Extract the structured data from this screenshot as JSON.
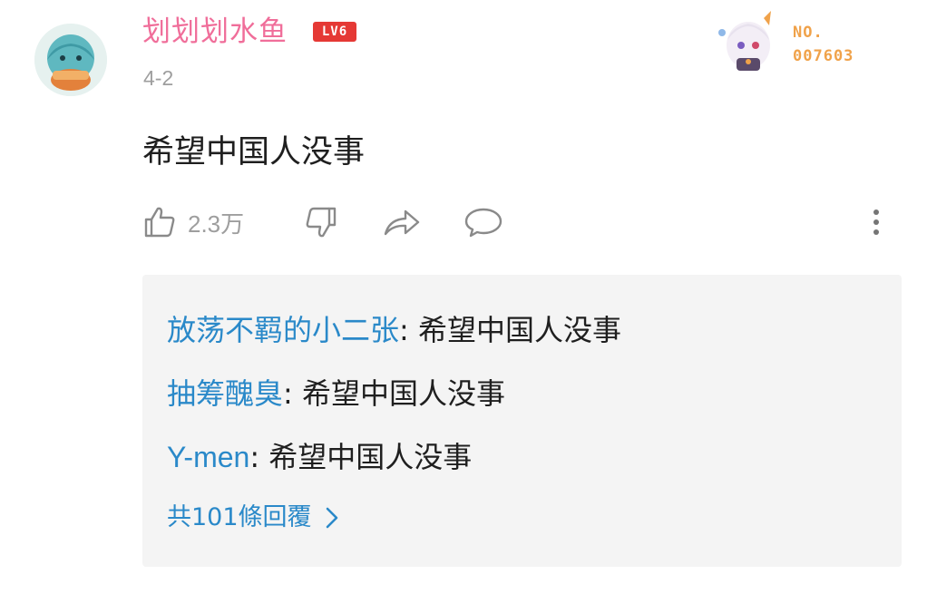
{
  "comment": {
    "username": "划划划水鱼",
    "level": "LV6",
    "date": "4-2",
    "text": "希望中国人没事",
    "fan_badge": {
      "label": "NO.",
      "number": "007603"
    }
  },
  "actions": {
    "like_count": "2.3万",
    "like_icon": "thumbs-up-icon",
    "dislike_icon": "thumbs-down-icon",
    "share_icon": "share-icon",
    "reply_icon": "comment-bubble-icon",
    "more_icon": "more-vertical-icon"
  },
  "replies": {
    "items": [
      {
        "author": "放荡不羁的小二张",
        "separator": ": ",
        "content": "希望中国人没事"
      },
      {
        "author": "抽筹醜臭",
        "separator": ": ",
        "content": "希望中国人没事"
      },
      {
        "author": "Y-men",
        "separator": ": ",
        "content": "希望中国人没事"
      }
    ],
    "view_all": "共101條回覆"
  },
  "colors": {
    "username": "#f06e9a",
    "level_badge": "#e53935",
    "reply_author": "#2a89c9",
    "muted": "#9e9e9e",
    "fan_badge": "#f0a24a",
    "replies_bg": "#f4f4f4"
  }
}
